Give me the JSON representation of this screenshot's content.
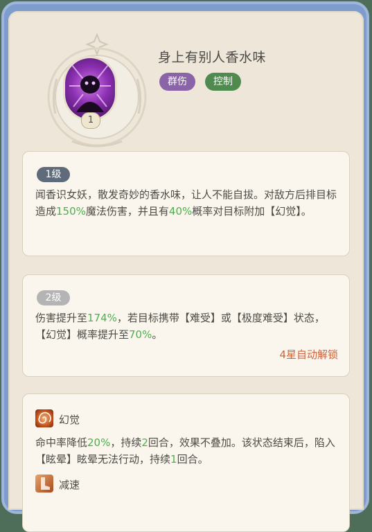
{
  "skill": {
    "name": "身上有别人香水味",
    "level_badge": "1",
    "tags": [
      {
        "label": "群伤",
        "color": "#8a63a8"
      },
      {
        "label": "控制",
        "color": "#4f8a4f"
      }
    ]
  },
  "levels": [
    {
      "label": "1级",
      "badge_color": "#5f6a7a",
      "desc_parts": [
        "闻香识女妖，散发奇妙的香水味，让人不能自拔。对敌方后排目标造成",
        "150%",
        "魔法伤害，并且有",
        "40%",
        "概率对目标附加【幻觉】。"
      ]
    },
    {
      "label": "2级",
      "badge_color": "#b4b4b4",
      "desc_parts": [
        "伤害提升至",
        "174%",
        "，若目标携带【难受】或【极度难受】状态，【幻觉】概率提升至",
        "70%",
        "。"
      ],
      "unlock": "4星自动解锁"
    }
  ],
  "effects": [
    {
      "name": "幻觉",
      "icon": "swirl-icon",
      "desc_parts": [
        "命中率降低",
        "20%",
        "，持续",
        "2",
        "回合，效果不叠加。该状态结束后，陷入【眩晕】眩晕无法行动，持续",
        "1",
        "回合。"
      ]
    },
    {
      "name": "减速",
      "icon": "boot-icon"
    }
  ],
  "colors": {
    "highlight": "#4bb04a",
    "unlock": "#d2623a"
  }
}
